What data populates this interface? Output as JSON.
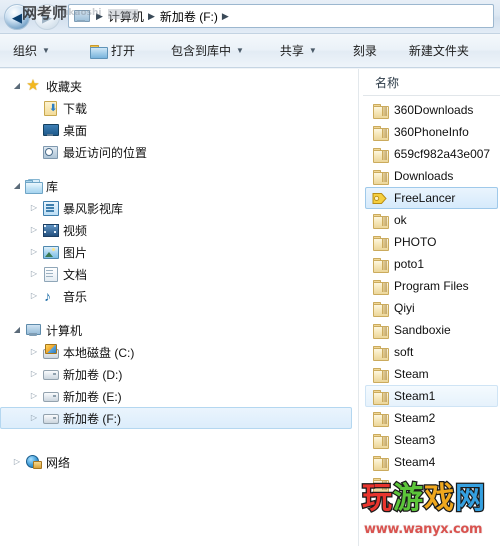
{
  "window": {
    "address_bar": {
      "back_button_label": "◀",
      "forward_button_label": "▶",
      "computer_icon": "computer-icon",
      "breadcrumbs": [
        "计算机",
        "新加卷 (F:)"
      ],
      "separator": "▶"
    },
    "watermark_top": {
      "text": "网考师",
      "faded_text": "ukaoshi"
    }
  },
  "toolbar": {
    "items": [
      {
        "label": "组织",
        "has_caret": true,
        "icon": null
      },
      {
        "label": "打开",
        "has_caret": false,
        "icon": "open-folder-icon"
      },
      {
        "label": "包含到库中",
        "has_caret": true,
        "icon": null
      },
      {
        "label": "共享",
        "has_caret": true,
        "icon": null
      },
      {
        "label": "刻录",
        "has_caret": false,
        "icon": null
      },
      {
        "label": "新建文件夹",
        "has_caret": false,
        "icon": null
      }
    ]
  },
  "navigation_pane": {
    "groups": [
      {
        "header": {
          "label": "收藏夹",
          "icon": "star-icon",
          "expander": "expanded",
          "indent": 0
        },
        "items": [
          {
            "label": "下载",
            "icon": "downloads-icon",
            "expander": "none",
            "indent": 1
          },
          {
            "label": "桌面",
            "icon": "desktop-icon",
            "expander": "none",
            "indent": 1
          },
          {
            "label": "最近访问的位置",
            "icon": "recent-places-icon",
            "expander": "none",
            "indent": 1
          }
        ]
      },
      {
        "header": {
          "label": "库",
          "icon": "library-icon",
          "expander": "expanded",
          "indent": 0
        },
        "items": [
          {
            "label": "暴风影视库",
            "icon": "video-library-icon",
            "expander": "collapsed",
            "indent": 1
          },
          {
            "label": "视频",
            "icon": "videos-icon",
            "expander": "collapsed",
            "indent": 1
          },
          {
            "label": "图片",
            "icon": "pictures-icon",
            "expander": "collapsed",
            "indent": 1
          },
          {
            "label": "文档",
            "icon": "documents-icon",
            "expander": "collapsed",
            "indent": 1
          },
          {
            "label": "音乐",
            "icon": "music-icon",
            "expander": "collapsed",
            "indent": 1
          }
        ]
      },
      {
        "header": {
          "label": "计算机",
          "icon": "computer-icon",
          "expander": "expanded",
          "indent": 0
        },
        "items": [
          {
            "label": "本地磁盘 (C:)",
            "icon": "system-drive-icon",
            "expander": "collapsed",
            "indent": 1,
            "selected": false
          },
          {
            "label": "新加卷 (D:)",
            "icon": "drive-icon",
            "expander": "collapsed",
            "indent": 1,
            "selected": false
          },
          {
            "label": "新加卷 (E:)",
            "icon": "drive-icon",
            "expander": "collapsed",
            "indent": 1,
            "selected": false
          },
          {
            "label": "新加卷 (F:)",
            "icon": "drive-icon",
            "expander": "collapsed",
            "indent": 1,
            "selected": true
          }
        ]
      },
      {
        "header": {
          "label": "网络",
          "icon": "network-icon",
          "expander": "collapsed",
          "indent": 0
        },
        "items": []
      }
    ]
  },
  "file_list": {
    "column_header": "名称",
    "rows": [
      {
        "name": "360Downloads",
        "icon": "folder-icon",
        "state": "normal"
      },
      {
        "name": "360PhoneInfo",
        "icon": "folder-icon",
        "state": "normal"
      },
      {
        "name": "659cf982a43e007",
        "icon": "folder-icon",
        "state": "normal"
      },
      {
        "name": "Downloads",
        "icon": "folder-icon",
        "state": "normal"
      },
      {
        "name": "FreeLancer",
        "icon": "tag-folder-icon",
        "state": "selected"
      },
      {
        "name": "ok",
        "icon": "folder-icon",
        "state": "normal"
      },
      {
        "name": "PHOTO",
        "icon": "folder-icon",
        "state": "normal"
      },
      {
        "name": "poto1",
        "icon": "folder-icon",
        "state": "normal"
      },
      {
        "name": "Program Files",
        "icon": "folder-icon",
        "state": "normal"
      },
      {
        "name": "Qiyi",
        "icon": "folder-icon",
        "state": "normal"
      },
      {
        "name": "Sandboxie",
        "icon": "folder-icon",
        "state": "normal"
      },
      {
        "name": "soft",
        "icon": "folder-icon",
        "state": "normal"
      },
      {
        "name": "Steam",
        "icon": "folder-icon",
        "state": "normal"
      },
      {
        "name": "Steam1",
        "icon": "folder-icon",
        "state": "hover"
      },
      {
        "name": "Steam2",
        "icon": "folder-icon",
        "state": "normal"
      },
      {
        "name": "Steam3",
        "icon": "folder-icon",
        "state": "normal"
      },
      {
        "name": "Steam4",
        "icon": "folder-icon",
        "state": "normal"
      },
      {
        "name": "",
        "icon": "folder-icon",
        "state": "normal"
      }
    ]
  },
  "watermark_bottom": {
    "chars": [
      "玩",
      "游",
      "戏",
      "网"
    ],
    "url": "www.wanyx.com"
  },
  "colors": {
    "selection_fill": "#d6eafb",
    "selection_border": "#9fc9ea",
    "folder_yellow": "#f7e9bf",
    "accent_blue": "#2d7bbd",
    "chrome_bg": "#e2ecf6"
  }
}
